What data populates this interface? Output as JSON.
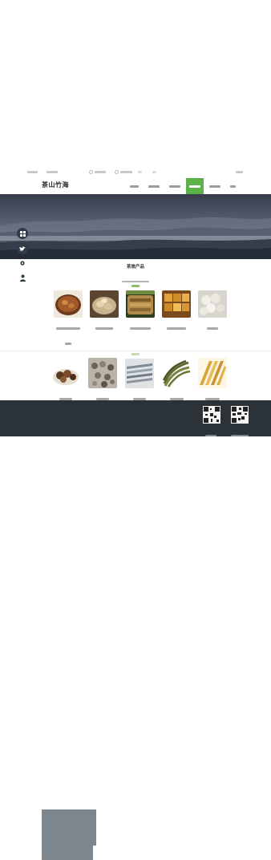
{
  "header": {
    "logo_text": "茶山竹海",
    "active_nav_index": 4
  },
  "products_section": {
    "title": "茶旅产品"
  },
  "colors": {
    "accent_green": "#5db14a",
    "footer_bg": "#2b3339",
    "side_icon_bg": "#2f3b45"
  },
  "icons": {
    "social": [
      "grid-icon",
      "twitter-icon",
      "gear-icon",
      "user-icon"
    ]
  }
}
